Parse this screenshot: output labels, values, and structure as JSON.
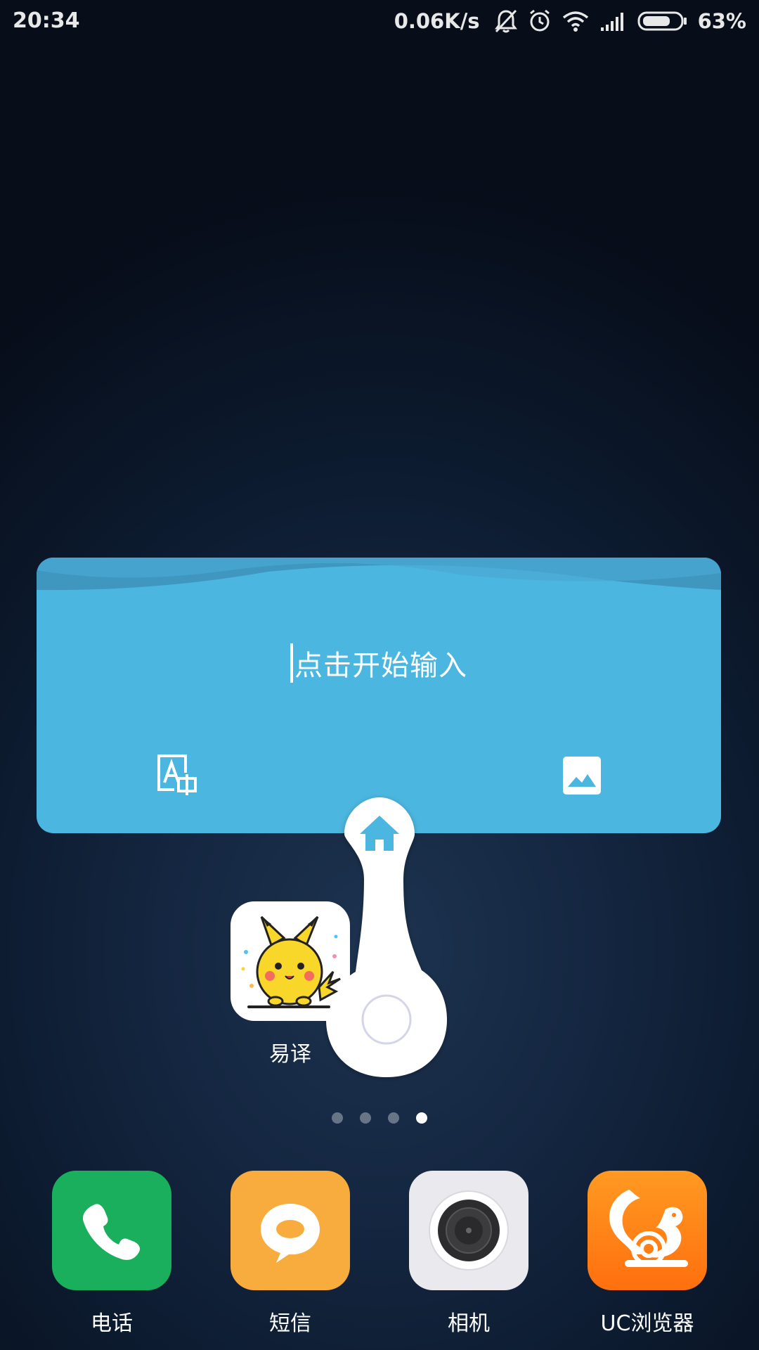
{
  "status_bar": {
    "time": "20:34",
    "net_speed": "0.06K/s",
    "battery": "63%",
    "icons": [
      "notifications-off-icon",
      "alarm-icon",
      "wifi-icon",
      "cellular-signal-icon",
      "battery-icon"
    ]
  },
  "widget": {
    "placeholder": "点击开始输入",
    "left_button_icon": "text-translate-icon",
    "right_button_icon": "image-icon",
    "color": "#4bb6df"
  },
  "float_handle": {
    "icon": "home-icon"
  },
  "page_apps": [
    {
      "label": "易译",
      "icon": "pikachu-app-icon"
    }
  ],
  "page_indicator": {
    "count": 4,
    "active_index": 3
  },
  "dock": [
    {
      "label": "电话",
      "icon": "phone-icon",
      "color": "#1aaf5d"
    },
    {
      "label": "短信",
      "icon": "message-icon",
      "color": "#f9ac3e"
    },
    {
      "label": "相机",
      "icon": "camera-icon",
      "color": "#e9e9ee"
    },
    {
      "label": "UC浏览器",
      "icon": "uc-browser-icon",
      "color": "#ff7f14"
    }
  ]
}
